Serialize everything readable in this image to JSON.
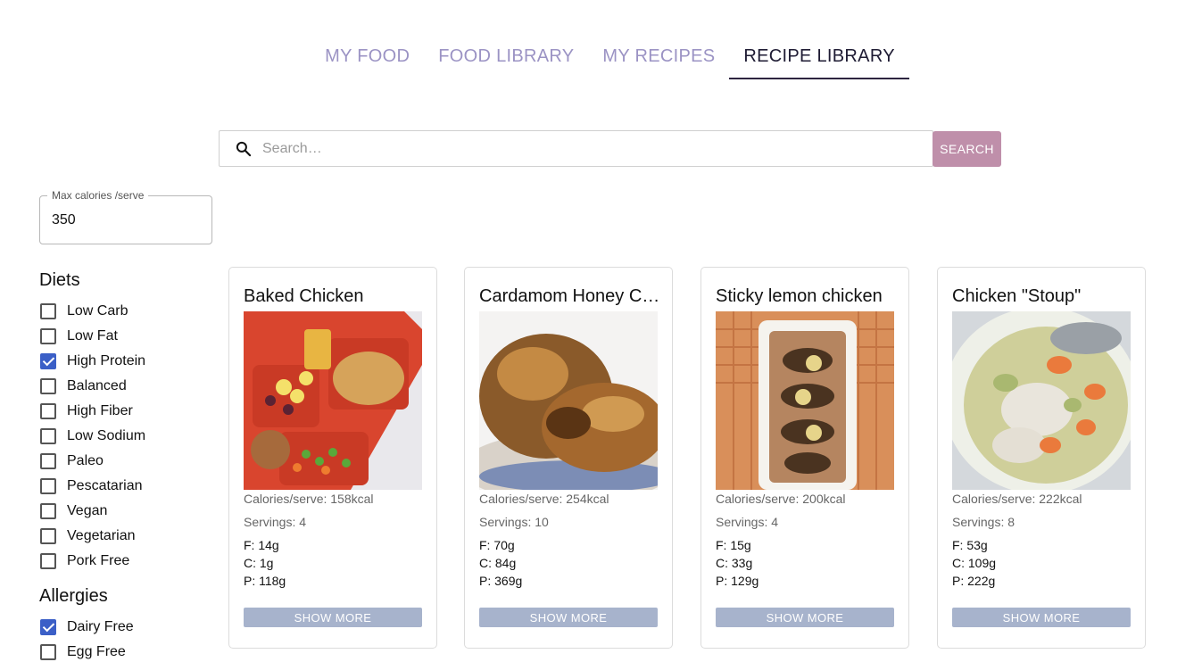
{
  "tabs": [
    {
      "label": "MY FOOD",
      "active": false
    },
    {
      "label": "FOOD LIBRARY",
      "active": false
    },
    {
      "label": "MY RECIPES",
      "active": false
    },
    {
      "label": "RECIPE LIBRARY",
      "active": true
    }
  ],
  "search": {
    "placeholder": "Search…",
    "value": "",
    "button_label": "SEARCH"
  },
  "max_calories": {
    "label": "Max calories /serve",
    "value": "350"
  },
  "diets": {
    "heading": "Diets",
    "items": [
      {
        "label": "Low Carb",
        "checked": false
      },
      {
        "label": "Low Fat",
        "checked": false
      },
      {
        "label": "High Protein",
        "checked": true
      },
      {
        "label": "Balanced",
        "checked": false
      },
      {
        "label": "High Fiber",
        "checked": false
      },
      {
        "label": "Low Sodium",
        "checked": false
      },
      {
        "label": "Paleo",
        "checked": false
      },
      {
        "label": "Pescatarian",
        "checked": false
      },
      {
        "label": "Vegan",
        "checked": false
      },
      {
        "label": "Vegetarian",
        "checked": false
      },
      {
        "label": "Pork Free",
        "checked": false
      }
    ]
  },
  "allergies": {
    "heading": "Allergies",
    "items": [
      {
        "label": "Dairy Free",
        "checked": true
      },
      {
        "label": "Egg Free",
        "checked": false
      }
    ]
  },
  "recipes": [
    {
      "title": "Baked Chicken",
      "calories": "Calories/serve: 158kcal",
      "servings": "Servings: 4",
      "fat": "F: 14g",
      "carbs": "C: 1g",
      "protein": "P: 118g",
      "button": "SHOW MORE"
    },
    {
      "title": "Cardamom Honey Chicken",
      "calories": "Calories/serve: 254kcal",
      "servings": "Servings: 10",
      "fat": "F: 70g",
      "carbs": "C: 84g",
      "protein": "P: 369g",
      "button": "SHOW MORE"
    },
    {
      "title": "Sticky lemon chicken",
      "calories": "Calories/serve: 200kcal",
      "servings": "Servings: 4",
      "fat": "F: 15g",
      "carbs": "C: 33g",
      "protein": "P: 129g",
      "button": "SHOW MORE"
    },
    {
      "title": "Chicken \"Stoup\"",
      "calories": "Calories/serve: 222kcal",
      "servings": "Servings: 8",
      "fat": "F: 53g",
      "carbs": "C: 109g",
      "protein": "P: 222g",
      "button": "SHOW MORE"
    }
  ],
  "colors": {
    "tab_inactive": "#9b93c4",
    "tab_active": "#1e1b33",
    "search_button": "#bf8faa",
    "checkbox_checked": "#3b5fc7",
    "show_more_button": "#a7b3cc"
  }
}
